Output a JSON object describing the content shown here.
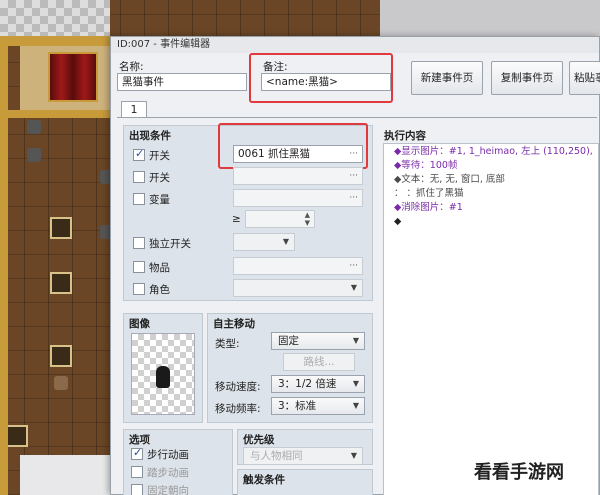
{
  "window": {
    "title": "ID:007 - 事件编辑器"
  },
  "name": {
    "label": "名称:",
    "value": "黑猫事件"
  },
  "note": {
    "label": "备注:",
    "value": "<name:黑猫>"
  },
  "toolbar": {
    "new_page": "新建事件页",
    "copy_page": "复制事件页",
    "paste_page": "粘贴事"
  },
  "tab": {
    "label": "1"
  },
  "conditions": {
    "title": "出现条件",
    "switch1": {
      "label": "开关",
      "value": "0061 抓住黑猫",
      "checked": true
    },
    "switch2": {
      "label": "开关",
      "value": ""
    },
    "variable": {
      "label": "变量",
      "value": ""
    },
    "ge": "≥",
    "self_switch": {
      "label": "独立开关",
      "value": ""
    },
    "item": {
      "label": "物品",
      "value": ""
    },
    "actor": {
      "label": "角色",
      "value": ""
    },
    "ellipsis": "···"
  },
  "image": {
    "title": "图像"
  },
  "autonomous": {
    "title": "自主移动",
    "type_label": "类型:",
    "type_value": "固定",
    "route_button": "路线...",
    "speed_label": "移动速度:",
    "speed_value": "3：1/2 倍速",
    "freq_label": "移动频率:",
    "freq_value": "3：标准"
  },
  "options": {
    "title": "选项",
    "walking": {
      "label": "步行动画",
      "checked": true
    },
    "stepping": {
      "label": "踏步动画"
    },
    "direction_fix": {
      "label": "固定朝向"
    }
  },
  "priority": {
    "title": "优先级",
    "value": "与人物相同"
  },
  "trigger": {
    "title": "触发条件"
  },
  "contents": {
    "title": "执行内容",
    "lines": [
      {
        "text": "◆显示图片：#1, 1_heimao, 左上 (110,250),",
        "color": "#7a2aa8"
      },
      {
        "text": "◆等待：100帧",
        "color": "#7a2aa8"
      },
      {
        "text": "◆文本：无, 无, 窗口, 底部",
        "color": "#4a4a4a"
      },
      {
        "text": "：       ：抓住了黑猫",
        "color": "#4a4a4a"
      },
      {
        "text": "◆消除图片：#1",
        "color": "#7a2aa8"
      },
      {
        "text": "◆",
        "color": "#222222"
      }
    ]
  },
  "watermark": "看看手游网"
}
